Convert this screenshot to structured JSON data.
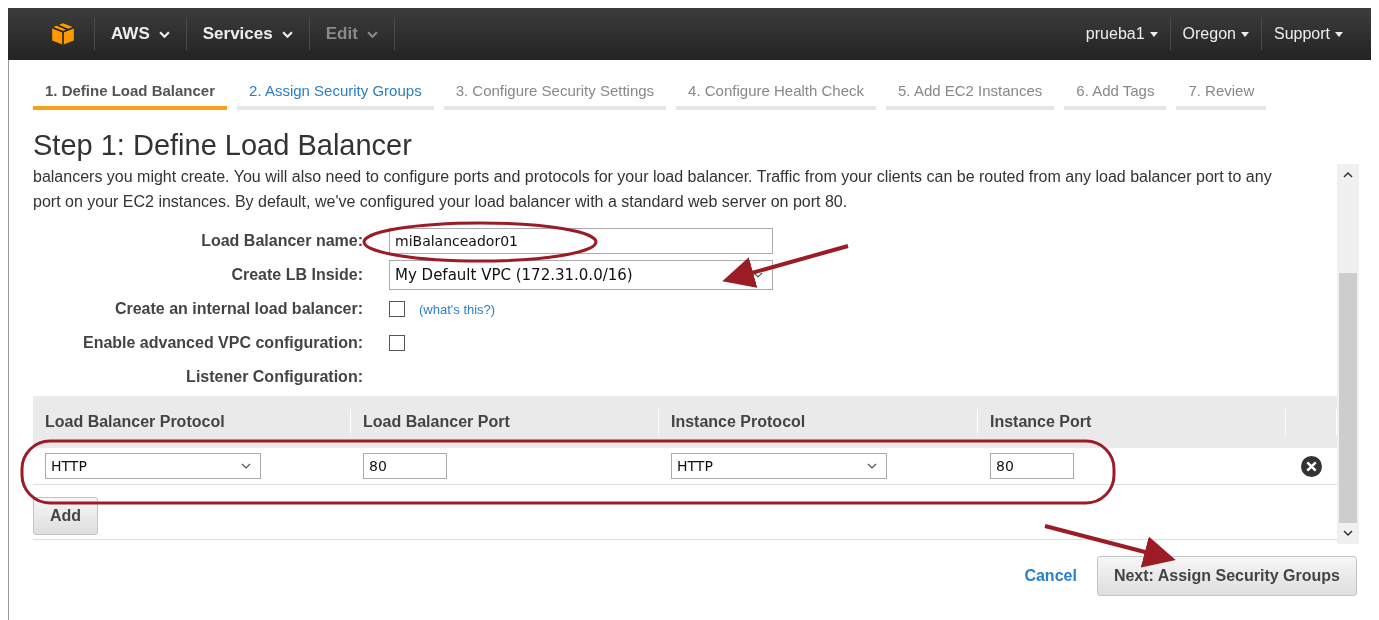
{
  "nav": {
    "left": [
      {
        "label": "AWS",
        "disabled": false
      },
      {
        "label": "Services",
        "disabled": false
      },
      {
        "label": "Edit",
        "disabled": true
      }
    ],
    "right": [
      {
        "label": "prueba1"
      },
      {
        "label": "Oregon"
      },
      {
        "label": "Support"
      }
    ]
  },
  "steps": [
    {
      "label": "1. Define Load Balancer",
      "selected": true,
      "enabled": true
    },
    {
      "label": "2. Assign Security Groups",
      "selected": false,
      "enabled": true
    },
    {
      "label": "3. Configure Security Settings",
      "selected": false,
      "enabled": false
    },
    {
      "label": "4. Configure Health Check",
      "selected": false,
      "enabled": false
    },
    {
      "label": "5. Add EC2 Instances",
      "selected": false,
      "enabled": false
    },
    {
      "label": "6. Add Tags",
      "selected": false,
      "enabled": false
    },
    {
      "label": "7. Review",
      "selected": false,
      "enabled": false
    }
  ],
  "title": "Step 1: Define Load Balancer",
  "description": "balancers you might create. You will also need to configure ports and protocols for your load balancer. Traffic from your clients can be routed from any load balancer port to any port on your EC2 instances. By default, we've configured your load balancer with a standard web server on port 80.",
  "form": [
    {
      "kind": "text",
      "label": "Load Balancer name:",
      "value": "miBalanceador01"
    },
    {
      "kind": "select",
      "label": "Create LB Inside:",
      "value": "My Default VPC (172.31.0.0/16)"
    },
    {
      "kind": "checkbox",
      "label": "Create an internal load balancer:",
      "checked": false,
      "help": "(what's this?)"
    },
    {
      "kind": "checkbox",
      "label": "Enable advanced VPC configuration:",
      "checked": false
    },
    {
      "kind": "heading",
      "label": "Listener Configuration:"
    }
  ],
  "listeners": {
    "columns": [
      "Load Balancer Protocol",
      "Load Balancer Port",
      "Instance Protocol",
      "Instance Port"
    ],
    "rows": [
      {
        "lb_protocol": "HTTP",
        "lb_port": "80",
        "instance_protocol": "HTTP",
        "instance_port": "80"
      }
    ],
    "add_button": "Add"
  },
  "footer": {
    "cancel": "Cancel",
    "next": "Next: Assign Security Groups"
  }
}
